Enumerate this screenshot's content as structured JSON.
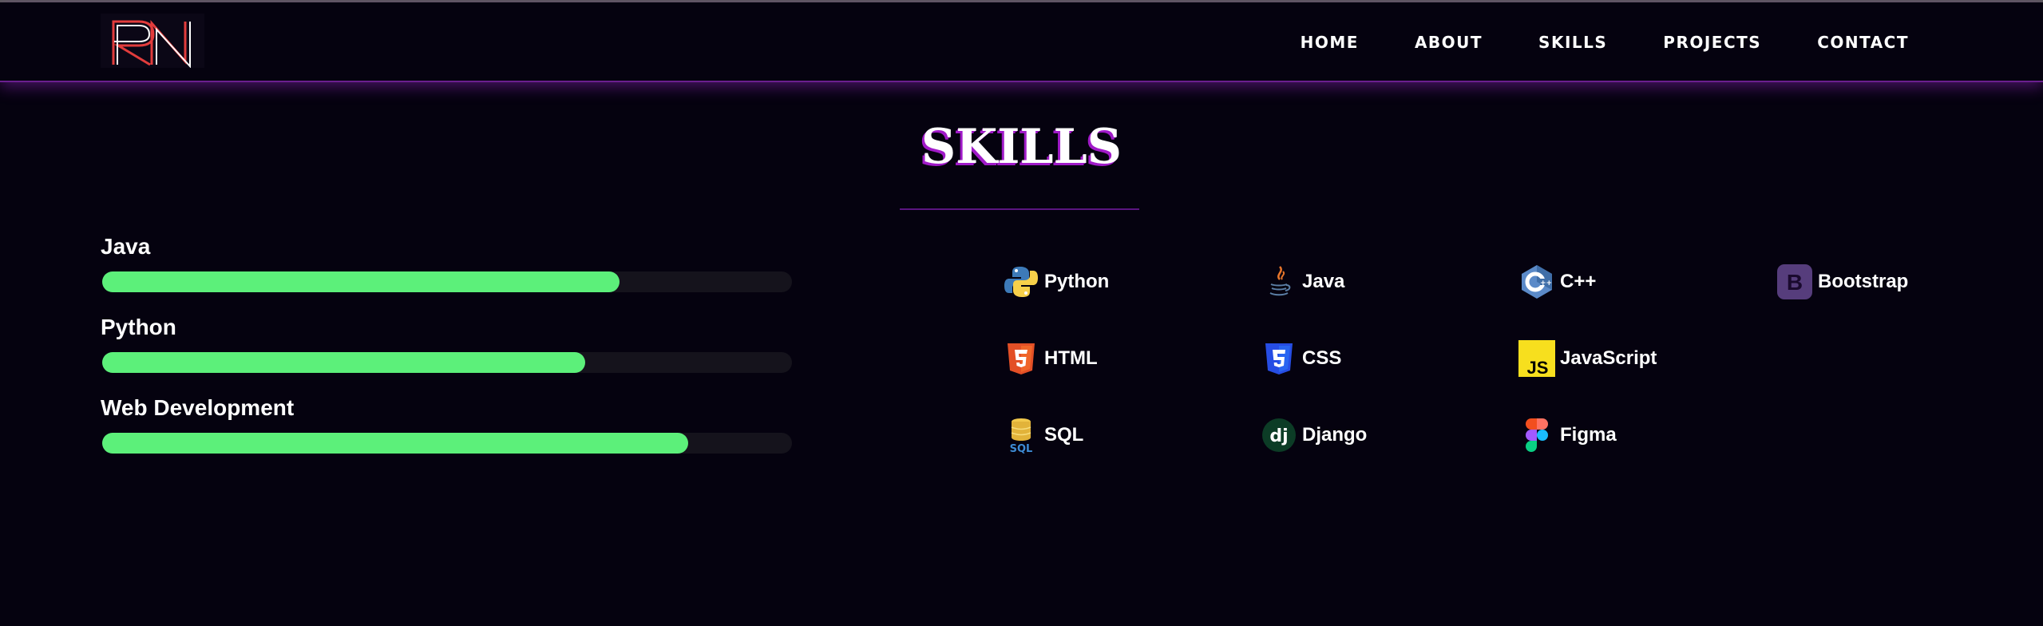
{
  "logo": {
    "text": "RN"
  },
  "nav": {
    "links": [
      {
        "label": "HOME"
      },
      {
        "label": "ABOUT"
      },
      {
        "label": "SKILLS"
      },
      {
        "label": "PROJECTS"
      },
      {
        "label": "CONTACT"
      }
    ]
  },
  "skills": {
    "title": "SKILLS",
    "bars": [
      {
        "name": "Java",
        "level": 0.75
      },
      {
        "name": "Python",
        "level": 0.7
      },
      {
        "name": "Web Development",
        "level": 0.85
      }
    ],
    "technologies": [
      {
        "label": "Python",
        "icon": "python-icon"
      },
      {
        "label": "Java",
        "icon": "java-icon"
      },
      {
        "label": "C++",
        "icon": "cpp-icon"
      },
      {
        "label": "Bootstrap",
        "icon": "bootstrap-icon"
      },
      {
        "label": "HTML",
        "icon": "html5-icon"
      },
      {
        "label": "CSS",
        "icon": "css3-icon"
      },
      {
        "label": "JavaScript",
        "icon": "javascript-icon"
      },
      {
        "label": "SQL",
        "icon": "sql-icon"
      },
      {
        "label": "Django",
        "icon": "django-icon"
      },
      {
        "label": "Figma",
        "icon": "figma-icon"
      }
    ]
  },
  "colors": {
    "background": "#05020f",
    "accent_purple": "#a01ac8",
    "bar_fill": "#5cf07a",
    "bar_track": "#15131c"
  }
}
